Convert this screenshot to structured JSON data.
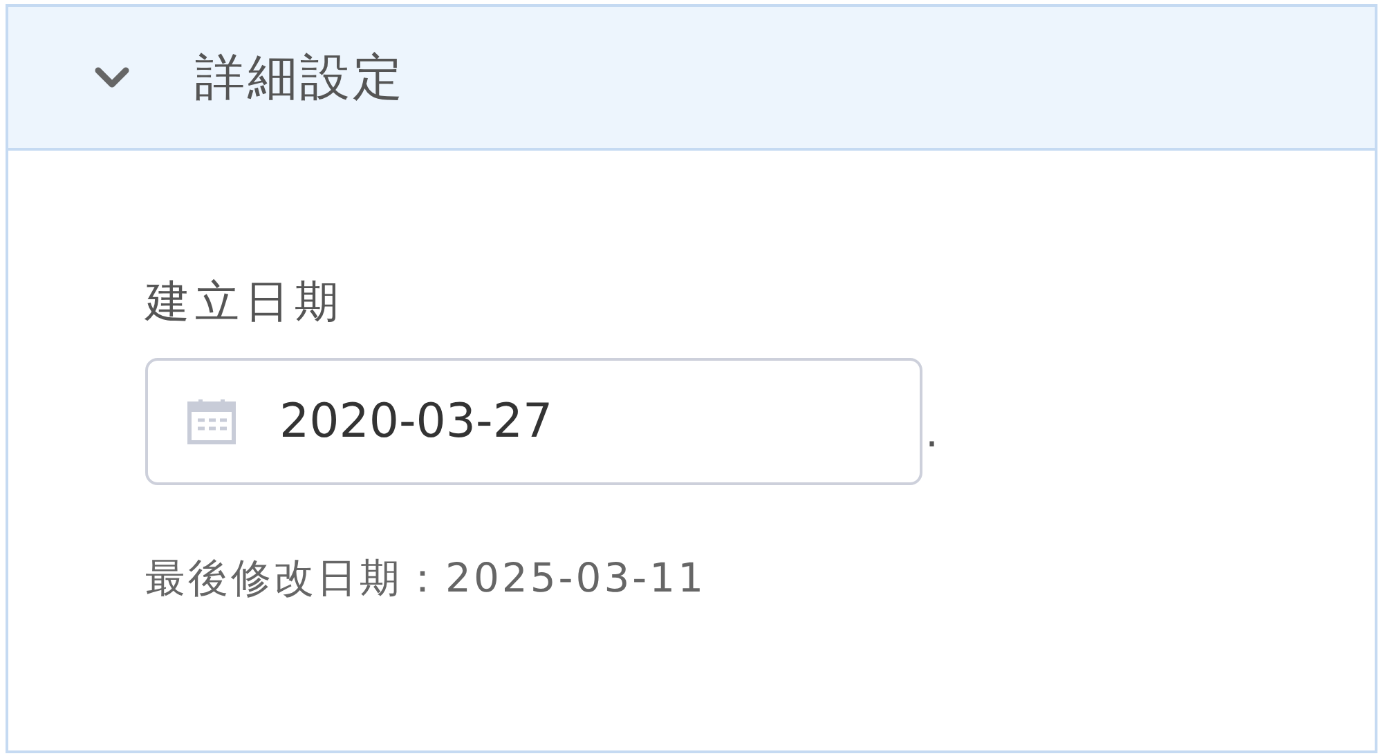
{
  "section": {
    "title": "詳細設定",
    "expanded": true,
    "fields": [
      {
        "label": "建立日期",
        "value": "2020-03-27",
        "suffix": "."
      }
    ],
    "note": "最後修改日期：2025-03-11"
  }
}
